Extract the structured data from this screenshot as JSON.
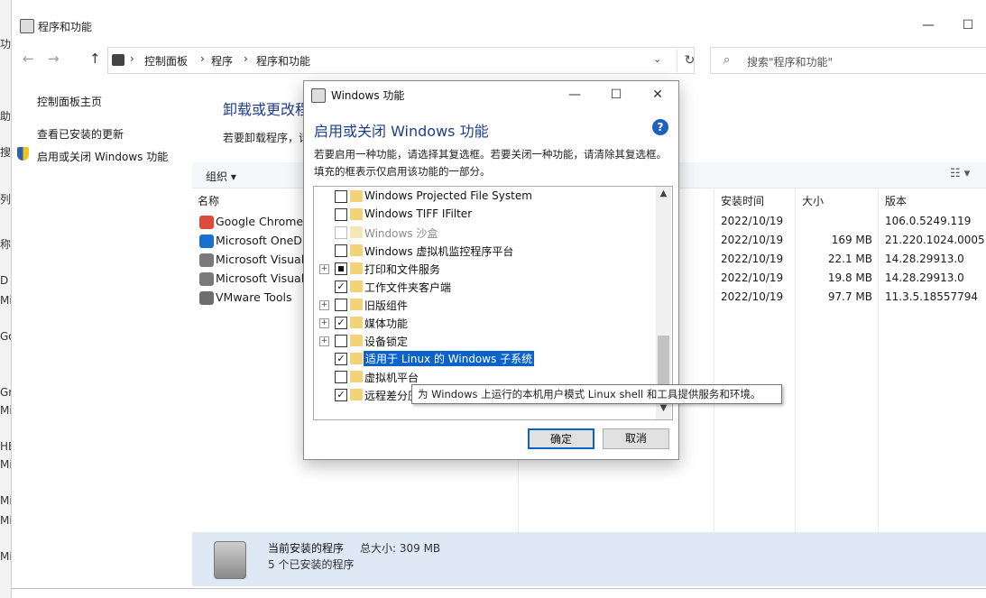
{
  "background_window": {
    "fragments": [
      "功",
      "助",
      "搜",
      "列",
      "称",
      "D",
      "Mi",
      "Go",
      "Gr",
      "Mi",
      "HE",
      "Mi",
      "Mi",
      "Mi",
      "Mi"
    ]
  },
  "window": {
    "title": "程序和功能",
    "controls": {
      "minimize": "—",
      "maximize": "☐"
    }
  },
  "nav": {
    "back": "←",
    "forward": "→",
    "up": "↑",
    "breadcrumbs": [
      "控制面板",
      "程序",
      "程序和功能"
    ],
    "separator": "›",
    "dropdown": "⌄",
    "refresh": "↻",
    "search_icon": "⌕",
    "search_placeholder": "搜索\"程序和功能\""
  },
  "sidebar": {
    "home": "控制面板主页",
    "updates": "查看已安装的更新",
    "features": "启用或关闭 Windows 功能",
    "features_icon": "shield-icon"
  },
  "main": {
    "title": "卸载或更改程",
    "description": "若要卸载程序，请",
    "organize": "组织 ▾",
    "view_icon": "☷ ▾",
    "columns": {
      "name": "名称",
      "installed": "安装时间",
      "size": "大小",
      "version": "版本"
    },
    "programs": [
      {
        "name": "Google Chrome",
        "installed": "2022/10/19",
        "size": "",
        "version": "106.0.5249.119",
        "icon_color": "#de4b39"
      },
      {
        "name": "Microsoft OneDrive",
        "installed": "2022/10/19",
        "size": "169 MB",
        "version": "21.220.1024.0005",
        "icon_color": "#1b6fd1"
      },
      {
        "name": "Microsoft Visual C++",
        "installed": "2022/10/19",
        "size": "22.1 MB",
        "version": "14.28.29913.0",
        "icon_color": "#7a7a7a"
      },
      {
        "name": "Microsoft Visual C++",
        "installed": "2022/10/19",
        "size": "19.8 MB",
        "version": "14.28.29913.0",
        "icon_color": "#7a7a7a"
      },
      {
        "name": "VMware Tools",
        "installed": "2022/10/19",
        "size": "97.7 MB",
        "version": "11.3.5.18557794",
        "icon_color": "#6d6d6d"
      }
    ]
  },
  "status": {
    "line1": "当前安装的程序",
    "total_size": "总大小:  309 MB",
    "line2": "5 个已安装的程序"
  },
  "dialog": {
    "title": "Windows 功能",
    "controls": {
      "minimize": "—",
      "maximize": "☐",
      "close": "✕"
    },
    "heading": "启用或关闭 Windows 功能",
    "help": "?",
    "description": "若要启用一种功能，请选择其复选框。若要关闭一种功能，请清除其复选框。填充的框表示仅启用该功能的一部分。",
    "features": [
      {
        "label": "Windows Projected File System",
        "state": "unchecked",
        "expander": "",
        "disabled": false,
        "selected": false
      },
      {
        "label": "Windows TIFF IFilter",
        "state": "unchecked",
        "expander": "",
        "disabled": false,
        "selected": false
      },
      {
        "label": "Windows 沙盒",
        "state": "unchecked",
        "expander": "",
        "disabled": true,
        "selected": false
      },
      {
        "label": "Windows 虚拟机监控程序平台",
        "state": "unchecked",
        "expander": "",
        "disabled": false,
        "selected": false
      },
      {
        "label": "打印和文件服务",
        "state": "partial",
        "expander": "+",
        "disabled": false,
        "selected": false
      },
      {
        "label": "工作文件夹客户端",
        "state": "checked",
        "expander": "",
        "disabled": false,
        "selected": false
      },
      {
        "label": "旧版组件",
        "state": "unchecked",
        "expander": "+",
        "disabled": false,
        "selected": false
      },
      {
        "label": "媒体功能",
        "state": "checked",
        "expander": "+",
        "disabled": false,
        "selected": false
      },
      {
        "label": "设备锁定",
        "state": "unchecked",
        "expander": "+",
        "disabled": false,
        "selected": false
      },
      {
        "label": "适用于 Linux 的 Windows 子系统",
        "state": "checked",
        "expander": "",
        "disabled": false,
        "selected": true
      },
      {
        "label": "虚拟机平台",
        "state": "unchecked",
        "expander": "",
        "disabled": false,
        "selected": false
      },
      {
        "label": "远程差分压缩 API 支持",
        "state": "checked",
        "expander": "",
        "disabled": false,
        "selected": false
      }
    ],
    "scroll_up": "▲",
    "scroll_down": "▼",
    "tooltip": "为 Windows 上运行的本机用户模式 Linux shell 和工具提供服务和环境。",
    "cursor": "➚",
    "ok": "确定",
    "cancel": "取消"
  },
  "colors": {
    "accent": "#0b62c9",
    "heading": "#1e3f8a",
    "statusbar": "#dfe8f5",
    "folder": "#f3d37a"
  }
}
